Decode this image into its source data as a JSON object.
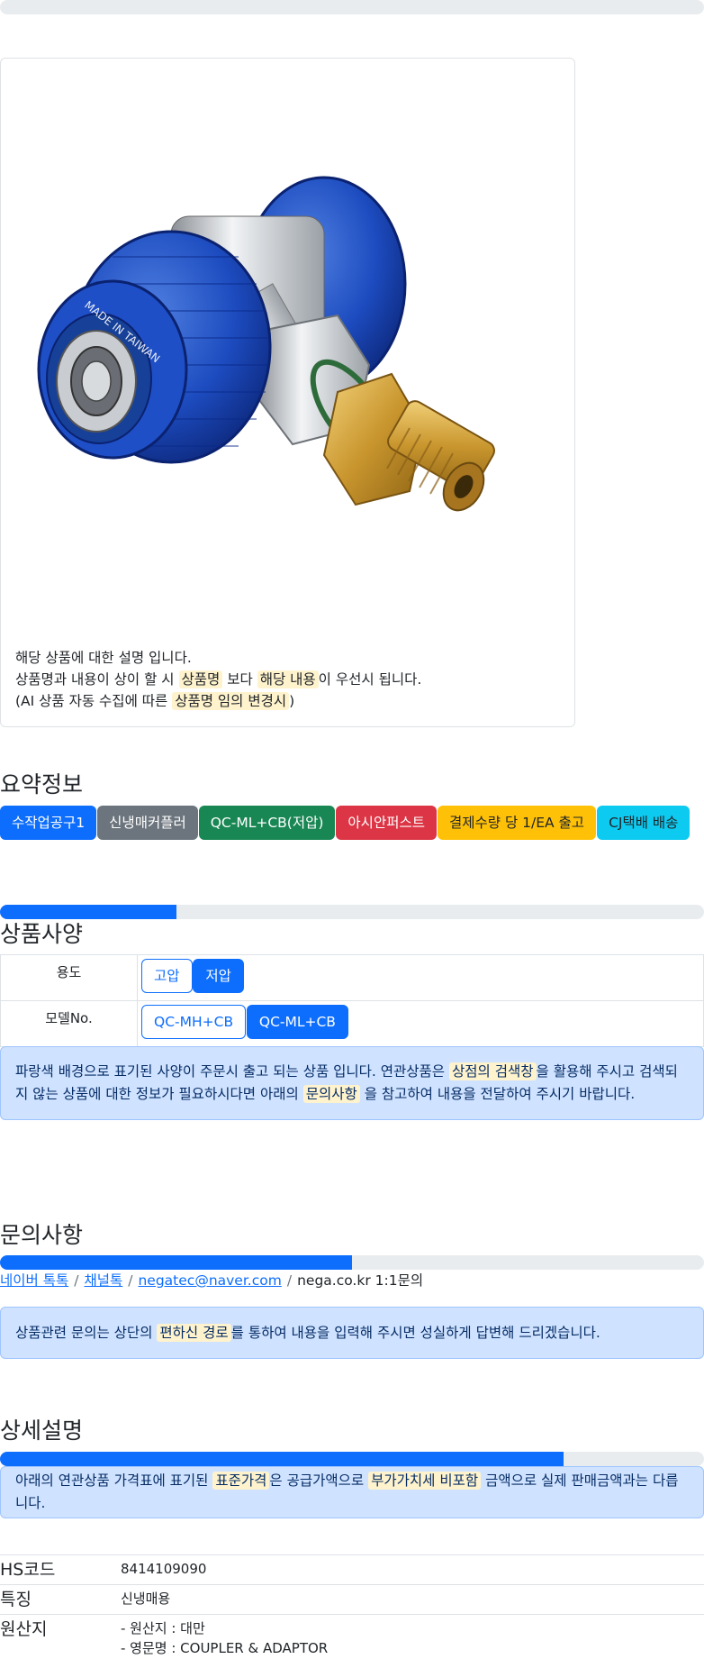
{
  "progress": {
    "top": 0.0,
    "spec": 0.25,
    "inquiry": 0.5,
    "detail": 0.8
  },
  "product_card": {
    "image_alt": "blue low side quick coupler with brass fitting",
    "image_engraving": "MADE IN TAIWAN",
    "desc_line1": "해당 상품에 대한 설명 입니다.",
    "desc_line2_a": "상품명과 내용이 상이 할 시",
    "desc_line2_hl1": "상품명",
    "desc_line2_b": "보다",
    "desc_line2_hl2": "해당 내용",
    "desc_line2_c": "이 우선시 됩니다.",
    "desc_line3_a": "(AI 상품 자동 수집에 따른",
    "desc_line3_hl": "상품명 임의 변경시",
    "desc_line3_b": ")"
  },
  "summary": {
    "heading": "요약정보",
    "badges": [
      "수작업공구1",
      "신냉매커플러",
      "QC-ML+CB(저압)",
      "아시안퍼스트",
      "결제수량 당 1/EA 출고",
      "CJ택배 배송"
    ]
  },
  "spec": {
    "heading": "상품사양",
    "rows": [
      {
        "label": "용도",
        "options": [
          "고압",
          "저압"
        ],
        "selected": "저압"
      },
      {
        "label": "모델No.",
        "options": [
          "QC-MH+CB",
          "QC-ML+CB"
        ],
        "selected": "QC-ML+CB"
      }
    ],
    "notice_a": "파랑색 배경으로 표기된 사양이 주문시 출고 되는 상품 입니다. 연관상품은",
    "notice_hl1": "상점의 검색창",
    "notice_b": "을 활용해 주시고 검색되지 않는 상품에 대한 정보가 필요하시다면 아래의",
    "notice_hl2": "문의사항",
    "notice_c": "을 참고하여 내용을 전달하여 주시기 바랍니다."
  },
  "inquiry": {
    "heading": "문의사항",
    "links": [
      "네이버 톡톡",
      "채널톡",
      "negatec@naver.com"
    ],
    "plain": "nega.co.kr 1:1문의",
    "notice_a": "상품관련 문의는 상단의",
    "notice_hl": "편하신 경로",
    "notice_b": "를 통하여 내용을 입력해 주시면 성실하게 답변해 드리겠습니다."
  },
  "detail": {
    "heading": "상세설명",
    "notice_a": "아래의 연관상품 가격표에 표기된",
    "notice_hl1": "표준가격",
    "notice_b": "은 공급가액으로",
    "notice_hl2": "부가가치세 비포함",
    "notice_c": "금액으로 실제 판매금액과는 다릅니다.",
    "rows": [
      {
        "key": "HS코드",
        "values": [
          "8414109090"
        ]
      },
      {
        "key": "특징",
        "values": [
          "신냉매용"
        ]
      },
      {
        "key": "원산지",
        "values": [
          "- 원산지 : 대만",
          "- 영문명 : COUPLER & ADAPTOR"
        ]
      }
    ]
  },
  "colors": {
    "primary": "#0d6efd",
    "highlight": "#fff3cd",
    "alert_bg": "#cfe2ff"
  }
}
